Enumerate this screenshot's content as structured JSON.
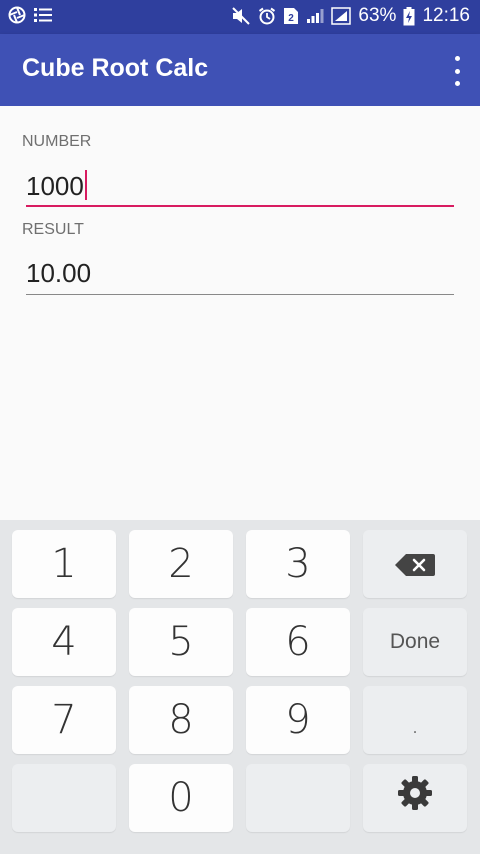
{
  "status_bar": {
    "battery_percent": "63%",
    "time": "12:16"
  },
  "app_bar": {
    "title": "Cube Root Calc"
  },
  "form": {
    "number_label": "NUMBER",
    "number_value": "1000",
    "result_label": "RESULT",
    "result_value": "10.00"
  },
  "keyboard": {
    "keys": [
      "1",
      "2",
      "3",
      "4",
      "5",
      "6",
      "7",
      "8",
      "9",
      "0",
      "."
    ],
    "done_label": "Done"
  },
  "colors": {
    "status_bar": "#2f3f9e",
    "app_bar": "#3f51b5",
    "accent": "#d81b60",
    "keyboard_bg": "#e4e6e8"
  }
}
